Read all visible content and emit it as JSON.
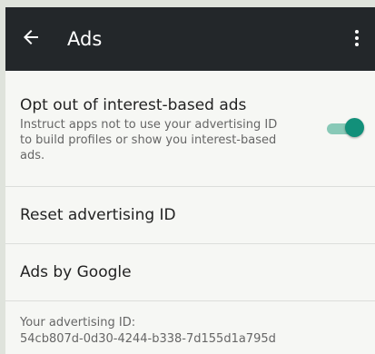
{
  "toolbar": {
    "title": "Ads"
  },
  "settings": {
    "opt_out": {
      "title": "Opt out of interest-based ads",
      "summary": "Instruct apps not to use your advertising ID to build profiles or show you interest-based ads.",
      "enabled": true
    },
    "reset": {
      "label": "Reset advertising ID"
    },
    "ads_by_google": {
      "label": "Ads by Google"
    },
    "advertising_id": {
      "label": "Your advertising ID:",
      "value": "54cb807d-0d30-4244-b338-7d155d1a795d"
    }
  },
  "colors": {
    "appbar": "#23272a",
    "accent": "#12907a",
    "track": "#88c9b7",
    "background": "#f6f7f4"
  },
  "icons": {
    "back": "arrow-back-icon",
    "overflow": "more-vert-icon"
  }
}
